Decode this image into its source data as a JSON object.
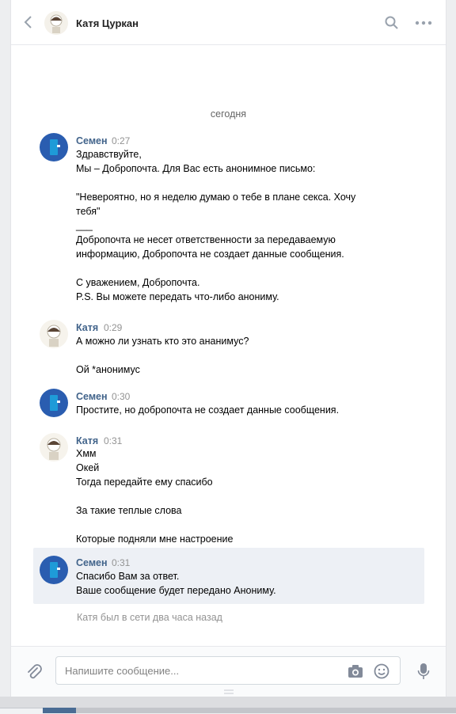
{
  "header": {
    "name": "Катя Цуркан"
  },
  "date_divider": "сегодня",
  "messages": [
    {
      "author": "Семен",
      "time": "0:27",
      "text": "Здравствуйте,\nМы – Добропочта. Для Вас есть анонимное письмо:\n\n\"Невероятно, но я неделю думаю о тебе в плане секса. Хочу\nтебя\"\n___\nДобропочта не несет ответственности за передаваемую\nинформацию, Добропочта не создает данные сообщения.\n\nС уважением, Добропочта.\nP.S. Вы можете передать что-либо анониму."
    },
    {
      "author": "Катя",
      "time": "0:29",
      "text": "А можно ли узнать кто это ананимус?\n\nОй *анонимус"
    },
    {
      "author": "Семен",
      "time": "0:30",
      "text": "Простите, но добропочта не создает данные сообщения."
    },
    {
      "author": "Катя",
      "time": "0:31",
      "text": "Хмм\nОкей\nТогда передайте ему спасибо\n\nЗа такие теплые слова\n\nКоторые подняли мне настроение"
    },
    {
      "author": "Семен",
      "time": "0:31",
      "text": "Спасибо Вам за ответ.\nВаше сообщение будет передано Анониму."
    }
  ],
  "status_text": "Катя был в сети два часа назад",
  "composer": {
    "placeholder": "Напишите сообщение..."
  },
  "colors": {
    "accent": "#42648b",
    "bot_avatar": "#2a5db0",
    "highlight": "#edf0f5"
  }
}
